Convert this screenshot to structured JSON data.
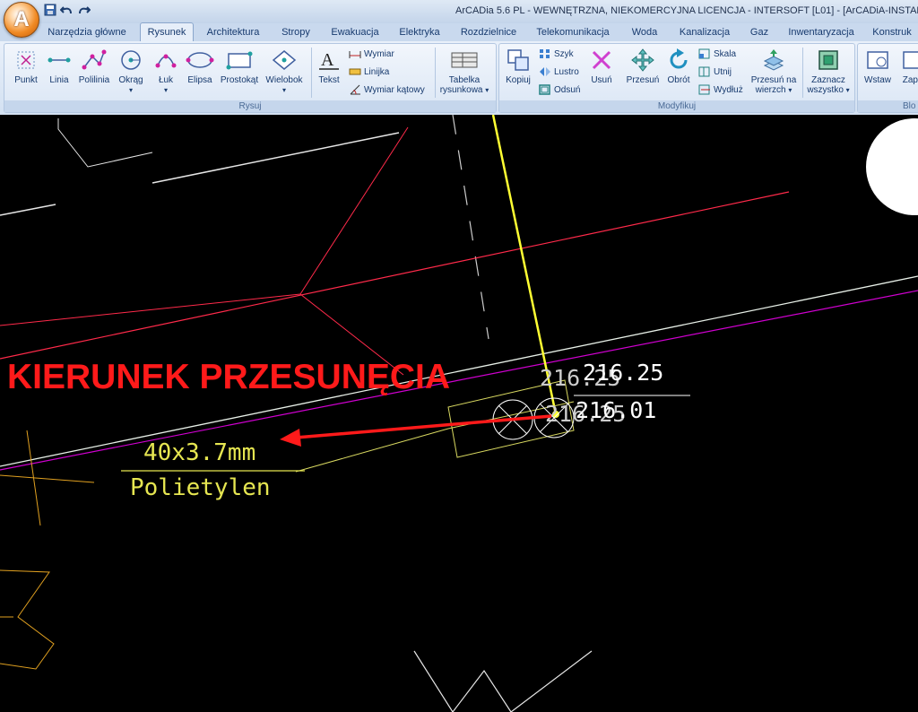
{
  "window": {
    "title": "ArCADia 5.6 PL - WEWNĘTRZNA, NIEKOMERCYJNA LICENCJA - INTERSOFT [L01] - [ArCADiA-INSTALACJE G"
  },
  "app_button": {
    "letter": "A"
  },
  "quick_access": [
    "save-icon",
    "undo-icon",
    "redo-icon"
  ],
  "tabs": [
    {
      "label": "Narzędzia główne"
    },
    {
      "label": "Rysunek",
      "active": true
    },
    {
      "label": "Architektura"
    },
    {
      "label": "Stropy"
    },
    {
      "label": "Ewakuacja"
    },
    {
      "label": "Elektryka"
    },
    {
      "label": "Rozdzielnice"
    },
    {
      "label": "Telekomunikacja"
    },
    {
      "label": "Woda"
    },
    {
      "label": "Kanalizacja"
    },
    {
      "label": "Gaz"
    },
    {
      "label": "Inwentaryzacja"
    },
    {
      "label": "Konstruk"
    }
  ],
  "ribbon": {
    "rysuj": {
      "caption": "Rysuj",
      "buttons": [
        {
          "label": "Punkt",
          "icon": "point-icon"
        },
        {
          "label": "Linia",
          "icon": "line-icon"
        },
        {
          "label": "Polilinia",
          "icon": "polyline-icon"
        },
        {
          "label": "Okrąg",
          "icon": "circle-icon"
        },
        {
          "label": "Łuk",
          "icon": "arc-icon"
        },
        {
          "label": "Elipsa",
          "icon": "ellipse-icon"
        },
        {
          "label": "Prostokąt",
          "icon": "rectangle-icon"
        },
        {
          "label": "Wielobok",
          "icon": "polygon-icon"
        }
      ]
    },
    "tekst": {
      "text_button": "Tekst",
      "small": [
        "Wymiar",
        "Linijka",
        "Wymiar kątowy"
      ],
      "tabelka_line1": "Tabelka",
      "tabelka_line2": "rysunkowa"
    },
    "modyfikuj": {
      "caption": "Modyfikuj",
      "kopiuj": "Kopiuj",
      "small_col": [
        "Szyk",
        "Lustro",
        "Odsuń"
      ],
      "usun": "Usuń",
      "przesun": "Przesuń",
      "obrot": "Obrót",
      "small_col2": [
        "Skala",
        "Utnij",
        "Wydłuż"
      ],
      "przesun_na_line1": "Przesuń na",
      "przesun_na_line2": "wierzch",
      "zaznacz_line1": "Zaznacz",
      "zaznacz_line2": "wszystko"
    },
    "next": {
      "wstaw": "Wstaw",
      "zapisz": "Zapis",
      "caption": "Blo"
    }
  },
  "drawing": {
    "annotation": "KIERUNEK PRZESUNĘCIA",
    "pipe_size": "40x3.7mm",
    "pipe_material": "Polietylen",
    "elevation_1": "216.25",
    "elevation_2": "216.25",
    "elevation_3": "216.25",
    "elevation_4": "216.01",
    "colors": {
      "annotation": "#ff1a1a",
      "pipe_label": "#e6e651",
      "magenta": "#d000d0",
      "red_line": "#ff2a4a",
      "yellow": "#ffff33",
      "white": "#ffffff",
      "orange": "#e0a020"
    }
  }
}
